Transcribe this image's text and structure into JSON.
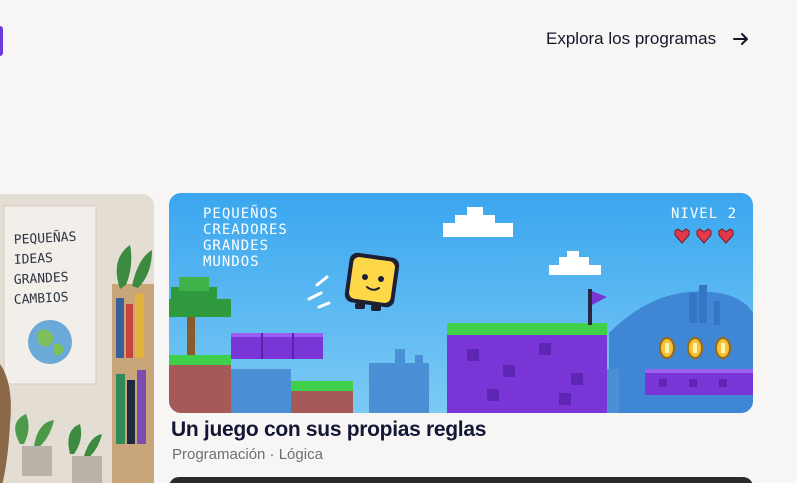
{
  "nav": {
    "explore_label": "Explora los programas",
    "arrow_icon": "arrow-right-icon"
  },
  "side_card": {
    "poster_lines": [
      "PEQUEÑAS",
      "IDEAS",
      "GRANDES",
      "CAMBIOS"
    ]
  },
  "feature_card": {
    "title": "Un juego con sus propias reglas",
    "meta": "Programación · Lógica",
    "game": {
      "tagline_lines": [
        "PEQUEÑOS",
        "CREADORES",
        "GRANDES",
        "MUNDOS"
      ],
      "level_label": "NIVEL 2",
      "lives": 3,
      "coins": 3
    }
  },
  "colors": {
    "accent": "#6b3ad9",
    "title": "#131634",
    "meta": "#6e6e76",
    "sky": "#4fb0ee",
    "grass": "#3fcf4a",
    "purple_block": "#7a35d6"
  }
}
